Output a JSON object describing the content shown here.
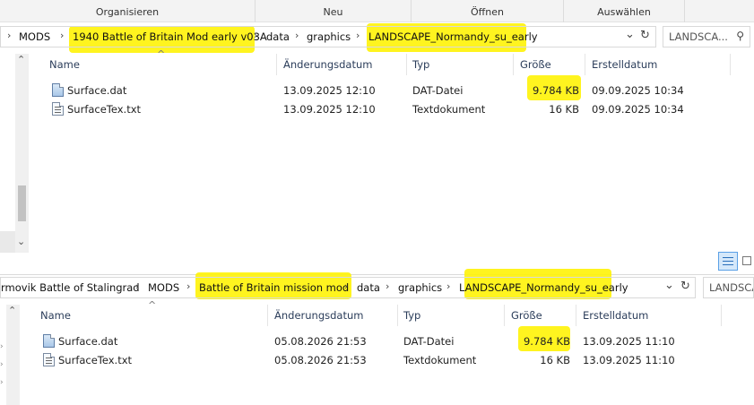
{
  "ribbon": {
    "groups": [
      "Organisieren",
      "Neu",
      "Öffnen",
      "Auswählen"
    ]
  },
  "top_window": {
    "breadcrumb": [
      "MODS",
      "1940 Battle of Britain Mod early v03A",
      "data",
      "graphics",
      "LANDSCAPE_Normandy_su_early"
    ],
    "search_placeholder": "LANDSCA...",
    "columns": {
      "name": "Name",
      "modified": "Änderungsdatum",
      "type": "Typ",
      "size": "Größe",
      "created": "Erstelldatum"
    },
    "files": [
      {
        "name": "Surface.dat",
        "modified": "13.09.2025 12:10",
        "type": "DAT-Datei",
        "size": "9.784 KB",
        "created": "09.09.2025 10:34",
        "icon": "dat-file-icon"
      },
      {
        "name": "SurfaceTex.txt",
        "modified": "13.09.2025 12:10",
        "type": "Textdokument",
        "size": "16 KB",
        "created": "09.09.2025 10:34",
        "icon": "text-file-icon"
      }
    ]
  },
  "bottom_window": {
    "breadcrumb": [
      "rmovik Battle of Stalingrad",
      "MODS",
      "Battle of Britain mission mod",
      "data",
      "graphics",
      "LANDSCAPE_Normandy_su_early"
    ],
    "search_placeholder": "LANDSCA",
    "columns": {
      "name": "Name",
      "modified": "Änderungsdatum",
      "type": "Typ",
      "size": "Größe",
      "created": "Erstelldatum"
    },
    "files": [
      {
        "name": "Surface.dat",
        "modified": "05.08.2026 21:53",
        "type": "DAT-Datei",
        "size": "9.784 KB",
        "created": "13.09.2025 11:10",
        "icon": "dat-file-icon"
      },
      {
        "name": "SurfaceTex.txt",
        "modified": "05.08.2026 21:53",
        "type": "Textdokument",
        "size": "16 KB",
        "created": "13.09.2025 11:10",
        "icon": "text-file-icon"
      }
    ]
  },
  "colors": {
    "highlight": "#fff200",
    "header_text": "#2b3d5a",
    "accent": "#0078d7"
  },
  "icons": {
    "chevron": "›",
    "dropdown": "⌄",
    "refresh": "↻",
    "search": "⚲",
    "sort_up": "^"
  }
}
